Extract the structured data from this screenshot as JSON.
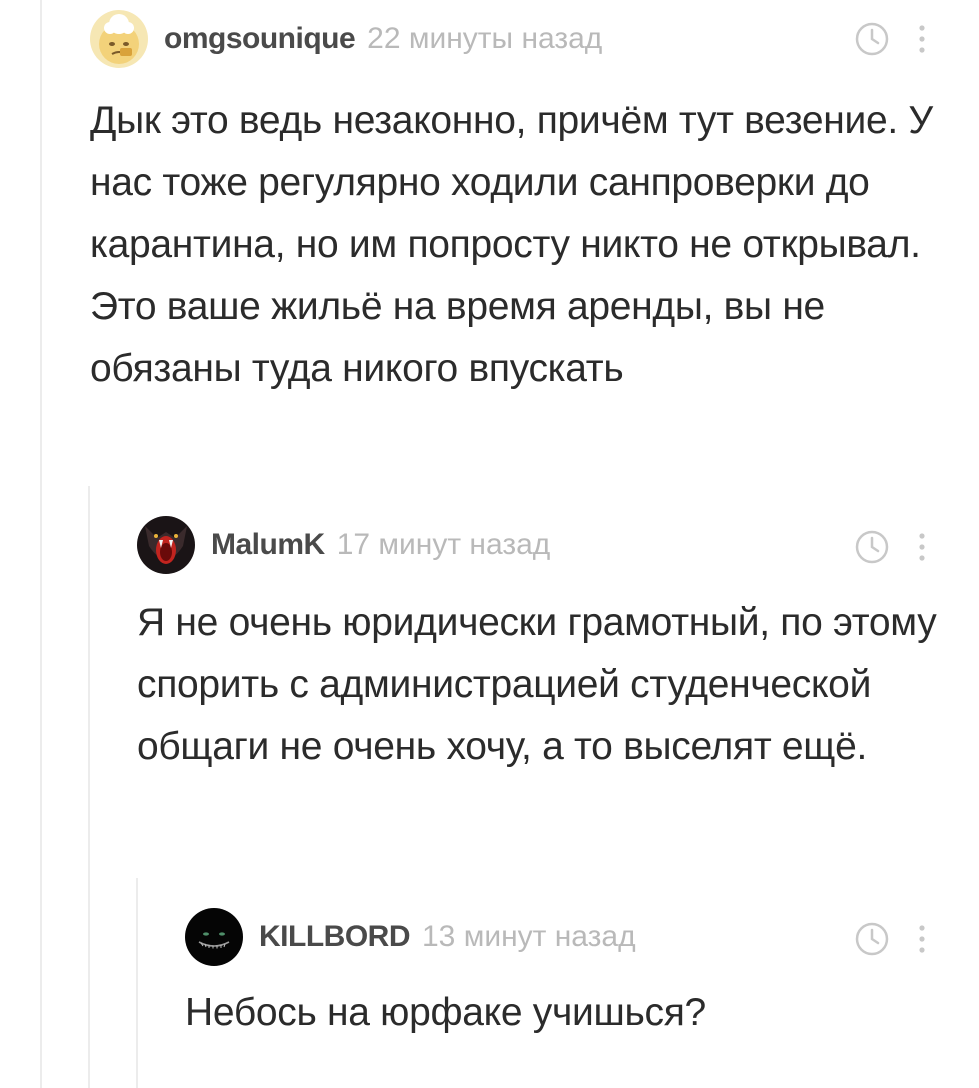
{
  "comments": [
    {
      "username": "omgsounique",
      "time": "22 минуты назад",
      "avatar_icon": "cat-face-icon",
      "text": "Дык это ведь незаконно, причём тут везение. У нас тоже регулярно ходили санпроверки до карантина, но им попросту никто не открывал.\nЭто ваше жильё на время аренды, вы не обязаны туда никого впускать"
    },
    {
      "username": "MalumK",
      "time": "17 минут назад",
      "avatar_icon": "red-monster-icon",
      "text": "Я не очень юридически грамотный, по этому спорить с администрацией студенческой общаги не очень хочу, а то выселят ещё."
    },
    {
      "username": "KILLBORD",
      "time": "13 минут назад",
      "avatar_icon": "dark-grin-icon",
      "text": "Небось на юрфаке учишься?"
    }
  ],
  "icons": {
    "clock": "clock-icon",
    "more": "more-vertical-icon"
  },
  "colors": {
    "username": "#4a4a4a",
    "timestamp": "#b9b9b9",
    "body_text": "#2b2b2b",
    "thread_line": "#ececec",
    "icon": "#c8c8c8"
  }
}
